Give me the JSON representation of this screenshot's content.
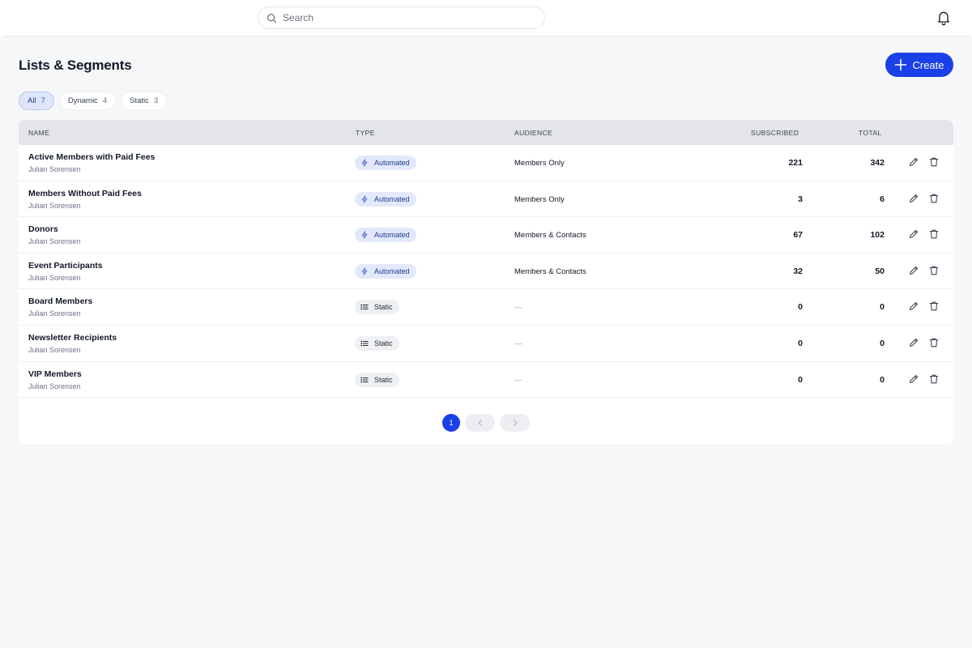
{
  "search": {
    "placeholder": "Search"
  },
  "page": {
    "title": "Lists & Segments"
  },
  "create_button": {
    "label": "Create"
  },
  "filters": [
    {
      "label": "All",
      "count": "7",
      "active": true
    },
    {
      "label": "Dynamic",
      "count": "4",
      "active": false
    },
    {
      "label": "Static",
      "count": "3",
      "active": false
    }
  ],
  "table": {
    "headers": {
      "name": "Name",
      "type": "Type",
      "audience": "Audience",
      "subscribed": "Subscribed",
      "total": "Total"
    },
    "rows": [
      {
        "name": "Active Members with Paid Fees",
        "owner": "Julian Sorensen",
        "type": "Automated",
        "audience": "Members Only",
        "subscribed": "221",
        "total": "342"
      },
      {
        "name": "Members Without Paid Fees",
        "owner": "Julian Sorensen",
        "type": "Automated",
        "audience": "Members Only",
        "subscribed": "3",
        "total": "6"
      },
      {
        "name": "Donors",
        "owner": "Julian Sorensen",
        "type": "Automated",
        "audience": "Members & Contacts",
        "subscribed": "67",
        "total": "102"
      },
      {
        "name": "Event Participants",
        "owner": "Julian Sorensen",
        "type": "Automated",
        "audience": "Members & Contacts",
        "subscribed": "32",
        "total": "50"
      },
      {
        "name": "Board Members",
        "owner": "Julian Sorensen",
        "type": "Static",
        "audience": "—",
        "subscribed": "0",
        "total": "0"
      },
      {
        "name": "Newsletter Recipients",
        "owner": "Julian Sorensen",
        "type": "Static",
        "audience": "—",
        "subscribed": "0",
        "total": "0"
      },
      {
        "name": "VIP Members",
        "owner": "Julian Sorensen",
        "type": "Static",
        "audience": "—",
        "subscribed": "0",
        "total": "0"
      }
    ]
  },
  "pagination": {
    "current_page": "1"
  },
  "colors": {
    "accent": "#1a40e8",
    "automated_badge_bg": "#e3e9fb",
    "static_badge_bg": "#eff0f2",
    "page_bg": "#f6f7f9"
  },
  "icons": [
    "search-icon",
    "bell-icon",
    "plus-icon",
    "bolt-icon",
    "list-icon",
    "pencil-icon",
    "trash-icon",
    "chevron-left-icon",
    "chevron-right-icon"
  ]
}
